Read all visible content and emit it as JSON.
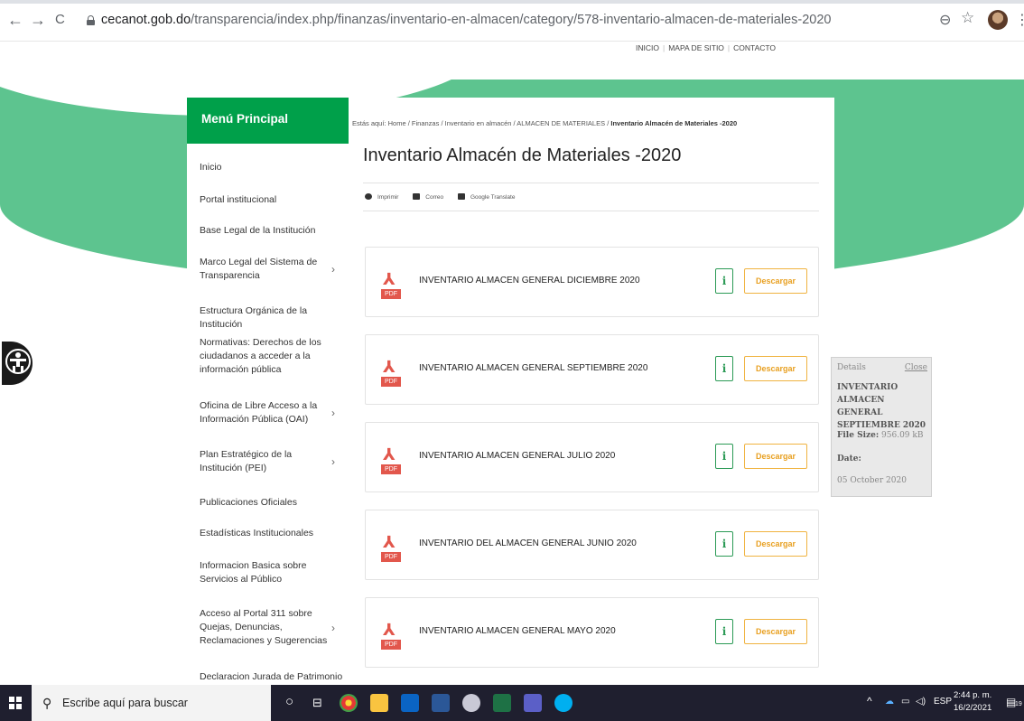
{
  "browser": {
    "back": "←",
    "forward": "→",
    "reload": "C",
    "url_host": "cecanot.gob.do",
    "url_path": "/transparencia/index.php/finanzas/inventario-en-almacen/category/578-inventario-almacen-de-materiales-2020",
    "zoom_icon": "⊖",
    "star_icon": "☆",
    "menu_icon": "⋮"
  },
  "util_links": [
    "INICIO",
    "MAPA DE SITIO",
    "CONTACTO"
  ],
  "sidebar": {
    "title": "Menú Principal",
    "items": [
      {
        "label": "Inicio",
        "has_children": false
      },
      {
        "label": "Portal institucional",
        "has_children": false
      },
      {
        "label": "Base Legal de la Institución",
        "has_children": false
      },
      {
        "label": "Marco Legal del Sistema de Transparencia",
        "has_children": true
      },
      {
        "label": "Estructura Orgánica de la Institución",
        "has_children": false
      },
      {
        "label": "Normativas: Derechos de los ciudadanos a acceder a la información pública",
        "has_children": false
      },
      {
        "label": "Oficina de Libre Acceso a la Información Pública (OAI)",
        "has_children": true
      },
      {
        "label": "Plan Estratégico de la Institución (PEI)",
        "has_children": true
      },
      {
        "label": "Publicaciones Oficiales",
        "has_children": false
      },
      {
        "label": "Estadísticas Institucionales",
        "has_children": false
      },
      {
        "label": "Informacion Basica sobre Servicios al Público",
        "has_children": false
      },
      {
        "label": "Acceso al Portal 311 sobre Quejas, Denuncias, Reclamaciones y Sugerencias",
        "has_children": true
      },
      {
        "label": "Declaracion Jurada de Patrimonio",
        "has_children": false
      }
    ]
  },
  "breadcrumb": {
    "prefix": "Estás aquí:",
    "items": [
      "Home",
      "Finanzas",
      "Inventario en almacén",
      "ALMACEN DE MATERIALES"
    ],
    "current": "Inventario Almacén de Materiales -2020",
    "separator": "/"
  },
  "page_title": "Inventario Almacén de Materiales -2020",
  "tools": {
    "print": "Imprimir",
    "email": "Correo",
    "translate": "Google Translate"
  },
  "files": [
    {
      "name": "INVENTARIO ALMACEN GENERAL DICIEMBRE 2020"
    },
    {
      "name": "INVENTARIO ALMACEN GENERAL SEPTIEMBRE 2020"
    },
    {
      "name": "INVENTARIO ALMACEN GENERAL JULIO 2020"
    },
    {
      "name": "INVENTARIO DEL ALMACEN GENERAL JUNIO 2020"
    },
    {
      "name": "INVENTARIO ALMACEN GENERAL MAYO 2020"
    }
  ],
  "file_labels": {
    "pdf_tag": "PDF",
    "info": "i",
    "download": "Descargar"
  },
  "details": {
    "label": "Details",
    "close": "Close",
    "file_name": "INVENTARIO ALMACEN GENERAL SEPTIEMBRE 2020",
    "size_label": "File Size:",
    "size_value": "956.09 kB",
    "date_label": "Date:",
    "date_value": "05 October 2020"
  },
  "taskbar": {
    "search_placeholder": "Escribe aquí para buscar",
    "lang": "ESP",
    "time": "2:44 p. m.",
    "date": "16/2/2021",
    "notification_count": "19"
  },
  "colors": {
    "brand_green": "#00a04a",
    "band_green": "#5dc48f",
    "download_orange": "#f0b340",
    "pdf_red": "#e2574c"
  }
}
